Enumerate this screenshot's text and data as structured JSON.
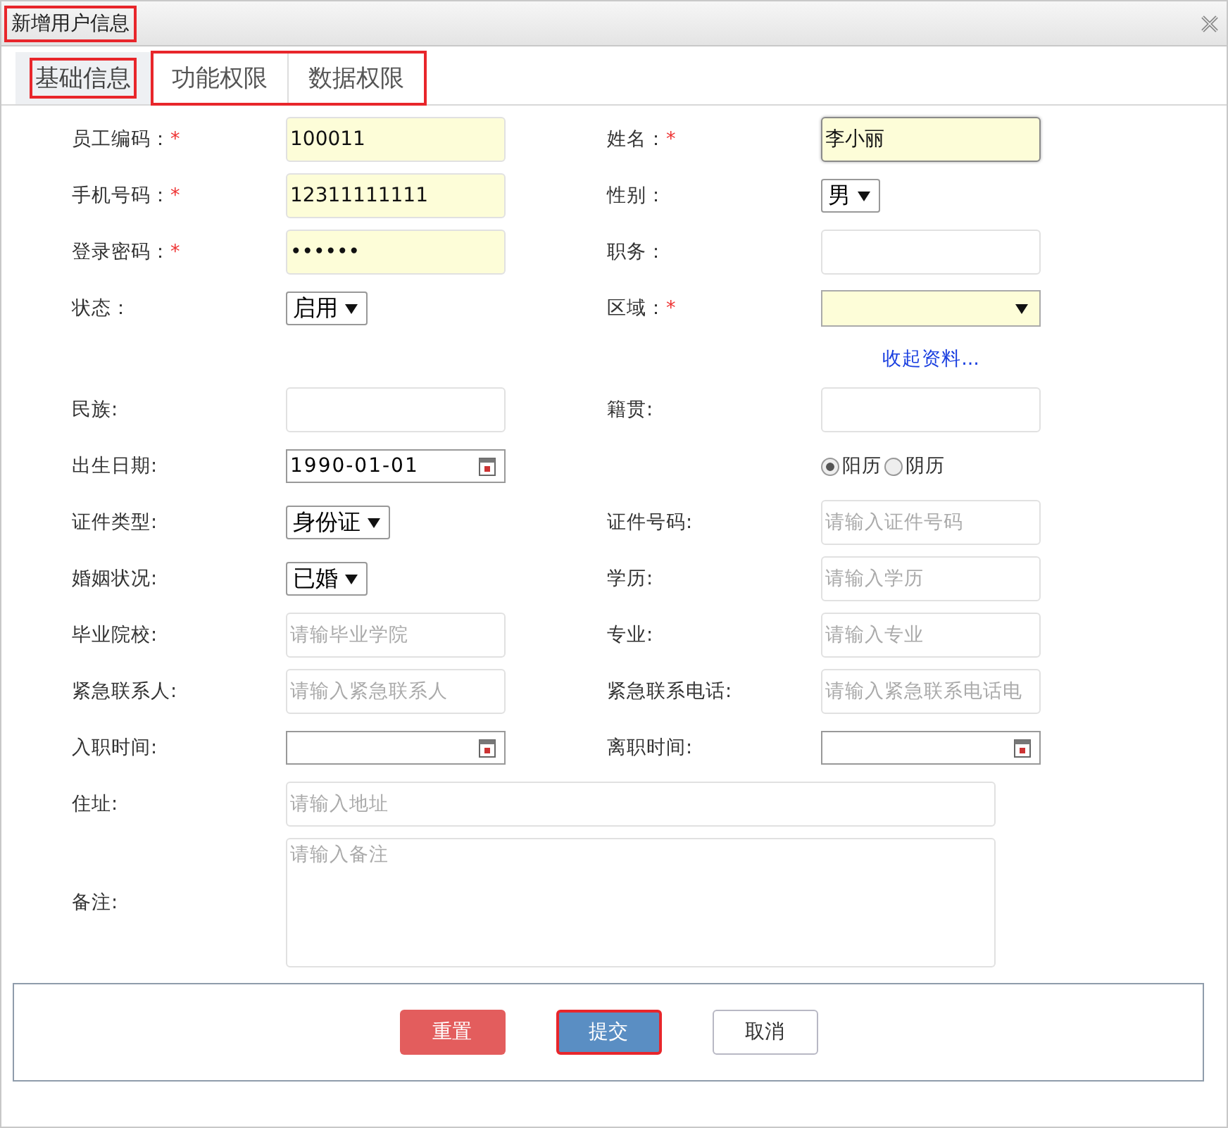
{
  "window": {
    "title": "新增用户信息",
    "highlighted": true
  },
  "tabs": [
    {
      "label": "基础信息",
      "selected": true,
      "highlighted": true
    },
    {
      "label": "功能权限",
      "selected": false,
      "highlighted": false
    },
    {
      "label": "数据权限",
      "selected": false,
      "highlighted": false
    }
  ],
  "tab_group_highlighted": true,
  "rows": [
    {
      "kind": "pair",
      "left": {
        "label": "员工编码：",
        "mark": "*",
        "required": true,
        "kind": "text",
        "value": "100011"
      },
      "right": {
        "label": "姓名：",
        "mark": "*",
        "required": true,
        "kind": "text",
        "value": "李小丽",
        "focused": true
      }
    },
    {
      "kind": "pair",
      "left": {
        "label": "手机号码：",
        "mark": "*",
        "required": true,
        "kind": "text",
        "value": "12311111111"
      },
      "right": {
        "label": "性别：",
        "kind": "select",
        "value": "男"
      }
    },
    {
      "kind": "pair",
      "left": {
        "label": "登录密码：",
        "mark": "*",
        "required": true,
        "kind": "password",
        "value": "••••••"
      },
      "right": {
        "label": "职务：",
        "kind": "text"
      }
    },
    {
      "kind": "pair",
      "left": {
        "label": "状态：",
        "kind": "select",
        "value": "启用"
      },
      "right": {
        "label": "区域：",
        "mark": "*",
        "required": true,
        "kind": "combo"
      }
    },
    {
      "kind": "link",
      "text": "收起资料..."
    },
    {
      "kind": "pair",
      "left": {
        "label": "民族:",
        "kind": "text"
      },
      "right": {
        "label": "籍贯:",
        "kind": "text"
      }
    },
    {
      "kind": "pair",
      "left": {
        "label": "出生日期:",
        "kind": "date",
        "value": "1990-01-01"
      },
      "right": {
        "kind": "radio",
        "options": [
          {
            "label": "阳历",
            "selected": true
          },
          {
            "label": "阴历",
            "selected": false
          }
        ]
      }
    },
    {
      "kind": "pair",
      "left": {
        "label": "证件类型:",
        "kind": "select",
        "value": "身份证"
      },
      "right": {
        "label": "证件号码:",
        "kind": "text",
        "placeholder": "请输入证件号码"
      }
    },
    {
      "kind": "pair",
      "left": {
        "label": "婚姻状况:",
        "kind": "select",
        "value": "已婚"
      },
      "right": {
        "label": "学历:",
        "kind": "text",
        "placeholder": "请输入学历"
      }
    },
    {
      "kind": "pair",
      "left": {
        "label": "毕业院校:",
        "kind": "text",
        "placeholder": "请输毕业学院"
      },
      "right": {
        "label": "专业:",
        "kind": "text",
        "placeholder": "请输入专业"
      }
    },
    {
      "kind": "pair",
      "left": {
        "label": "紧急联系人:",
        "kind": "text",
        "placeholder": "请输入紧急联系人"
      },
      "right": {
        "label": "紧急联系电话:",
        "kind": "text",
        "placeholder": "请输入紧急联系电话电"
      }
    },
    {
      "kind": "pair",
      "left": {
        "label": "入职时间:",
        "kind": "date"
      },
      "right": {
        "label": "离职时间:",
        "kind": "date"
      }
    },
    {
      "kind": "wide_text",
      "label": "住址:",
      "placeholder": "请输入地址"
    },
    {
      "kind": "wide_area",
      "label": "备注:",
      "placeholder": "请输入备注"
    }
  ],
  "buttons": [
    {
      "label": "重置",
      "kind": "danger",
      "highlighted": false
    },
    {
      "label": "提交",
      "kind": "primary",
      "highlighted": true
    },
    {
      "label": "取消",
      "kind": "plain",
      "highlighted": false
    }
  ]
}
